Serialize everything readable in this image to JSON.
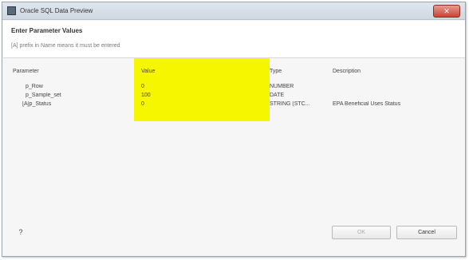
{
  "window": {
    "title": "Oracle SQL Data Preview",
    "close_glyph": "✕"
  },
  "header": {
    "title": "Enter Parameter Values",
    "description": "[A] prefix in Name means it must be entered"
  },
  "table": {
    "headers": {
      "parameter": "Parameter",
      "value": "Value",
      "type": "Type",
      "description": "Description"
    },
    "rows": [
      {
        "name": "p_Row",
        "value": "0",
        "type": "NUMBER",
        "description": ""
      },
      {
        "name": "p_Sample_set",
        "value": "100",
        "type": "DATE",
        "description": ""
      },
      {
        "name": "[A]p_Status",
        "value": "0",
        "type": "STRING (STC...",
        "description": "EPA Beneficial Uses Status"
      }
    ]
  },
  "footer": {
    "help_glyph": "?",
    "ok_label": "OK",
    "cancel_label": "Cancel"
  },
  "colors": {
    "highlight": "#f6f600",
    "titlebar": "#d6dee7",
    "close_button": "#c7453a"
  }
}
